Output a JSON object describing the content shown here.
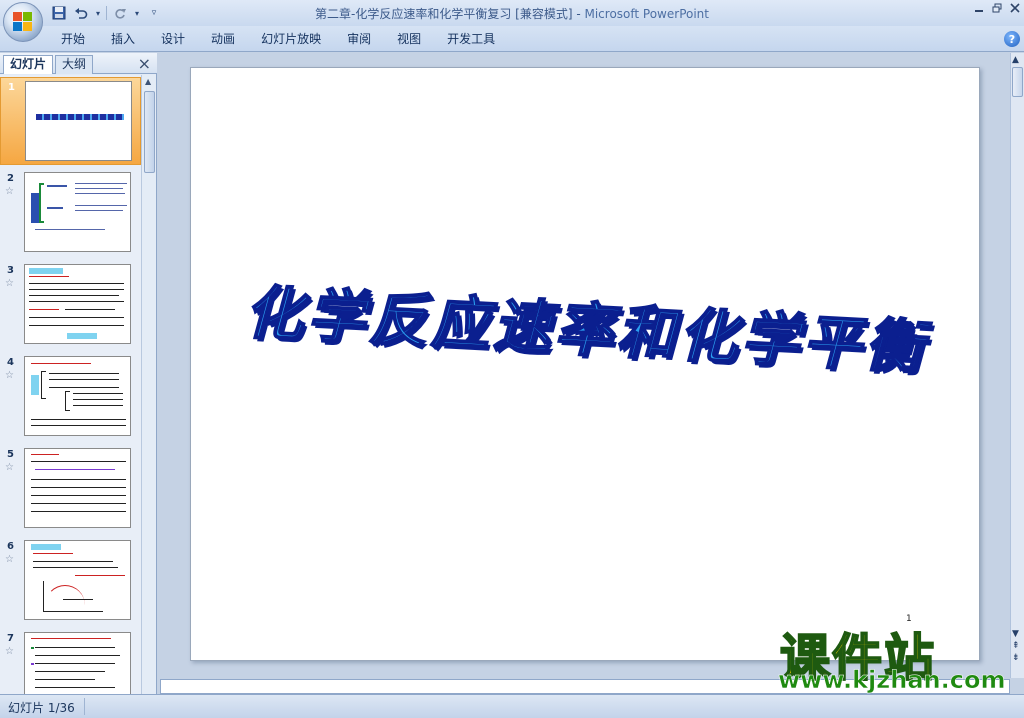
{
  "window": {
    "title_doc": "第二章-化学反应速率和化学平衡复习 [兼容模式]",
    "title_sep": " - ",
    "title_app": "Microsoft PowerPoint"
  },
  "quick_access": [
    "save-icon",
    "undo-icon",
    "redo-icon",
    "customize-dropdown-icon"
  ],
  "ribbon": {
    "tabs": [
      "开始",
      "插入",
      "设计",
      "动画",
      "幻灯片放映",
      "审阅",
      "视图",
      "开发工具"
    ]
  },
  "left_pane": {
    "tab_slides": "幻灯片",
    "tab_outline": "大纲",
    "close_label": "×",
    "slides": [
      {
        "num": "1"
      },
      {
        "num": "2"
      },
      {
        "num": "3"
      },
      {
        "num": "4"
      },
      {
        "num": "5"
      },
      {
        "num": "6"
      },
      {
        "num": "7"
      }
    ],
    "selected_index": 1
  },
  "slide": {
    "title": "化学反应速率和化学平衡",
    "page_number": "1"
  },
  "status_bar": {
    "slide_indicator": "幻灯片 1/36"
  },
  "watermark": {
    "chinese": "课件站",
    "url": "www.kjzhan.com"
  },
  "colors": {
    "title_fill": "#2a9ef0",
    "title_outline": "#0b1f8f",
    "selected_thumb": "#f5a742",
    "watermark_yellow": "#f2d200",
    "watermark_green": "#1f8a10"
  }
}
